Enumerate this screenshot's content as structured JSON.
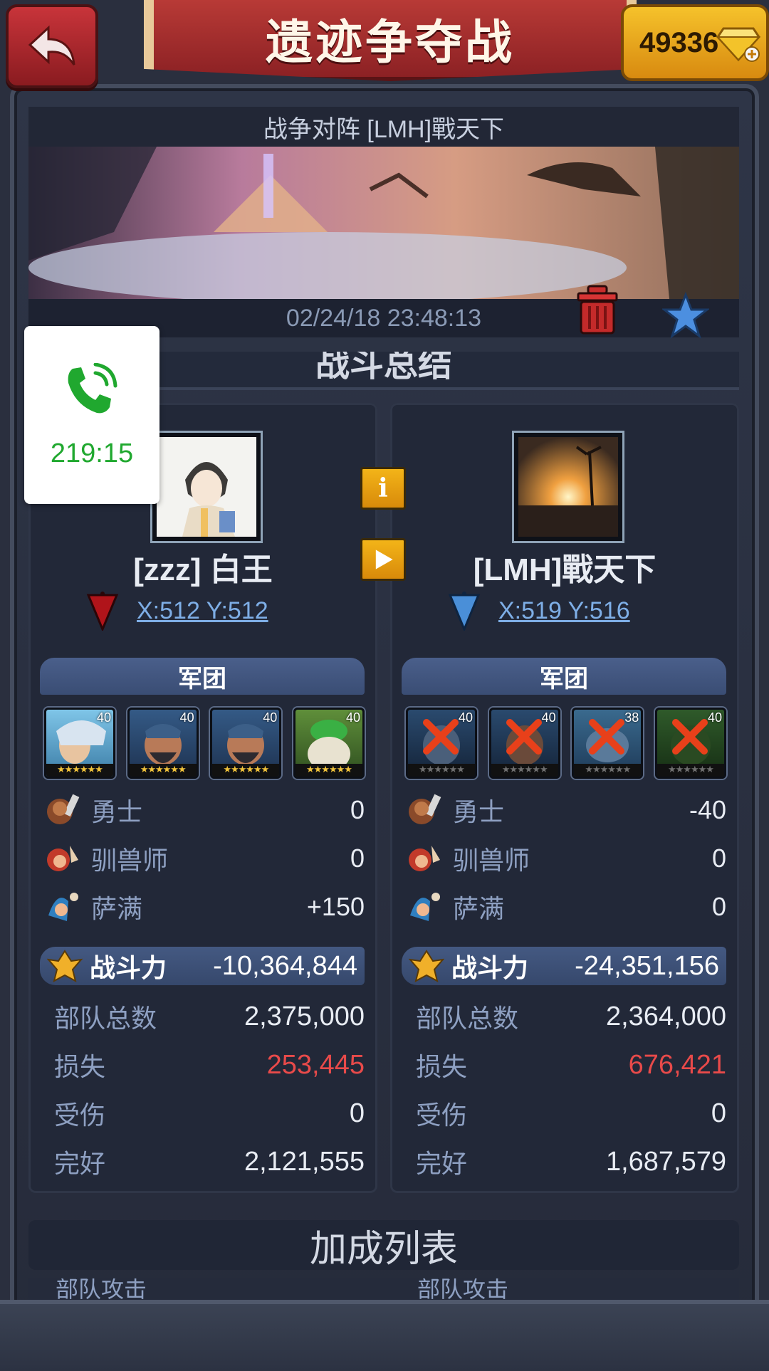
{
  "header": {
    "title": "遗迹争夺战",
    "gems": "49336"
  },
  "battle": {
    "title": "战争对阵 [LMH]戰天下",
    "timestamp": "02/24/18 23:48:13",
    "summary_label": "战斗总结"
  },
  "call_overlay": {
    "timer": "219:15"
  },
  "left": {
    "player_name": "[zzz] 白王",
    "coords": "X:512 Y:512",
    "legion_label": "军团",
    "heroes": [
      {
        "level": "40",
        "dead": false
      },
      {
        "level": "40",
        "dead": false
      },
      {
        "level": "40",
        "dead": false
      },
      {
        "level": "40",
        "dead": false
      }
    ],
    "units": [
      {
        "name": "勇士",
        "value": "0"
      },
      {
        "name": "驯兽师",
        "value": "0"
      },
      {
        "name": "萨满",
        "value": "+150"
      }
    ],
    "power_label": "战斗力",
    "power_value": "-10,364,844",
    "stats": [
      {
        "label": "部队总数",
        "value": "2,375,000",
        "red": false
      },
      {
        "label": "损失",
        "value": "253,445",
        "red": true
      },
      {
        "label": "受伤",
        "value": "0",
        "red": false
      },
      {
        "label": "完好",
        "value": "2,121,555",
        "red": false
      }
    ]
  },
  "right": {
    "player_name": "[LMH]戰天下",
    "coords": "X:519 Y:516",
    "legion_label": "军团",
    "heroes": [
      {
        "level": "40",
        "dead": true
      },
      {
        "level": "40",
        "dead": true
      },
      {
        "level": "38",
        "dead": true
      },
      {
        "level": "40",
        "dead": true
      }
    ],
    "units": [
      {
        "name": "勇士",
        "value": "-40"
      },
      {
        "name": "驯兽师",
        "value": "0"
      },
      {
        "name": "萨满",
        "value": "0"
      }
    ],
    "power_label": "战斗力",
    "power_value": "-24,351,156",
    "stats": [
      {
        "label": "部队总数",
        "value": "2,364,000",
        "red": false
      },
      {
        "label": "损失",
        "value": "676,421",
        "red": true
      },
      {
        "label": "受伤",
        "value": "0",
        "red": false
      },
      {
        "label": "完好",
        "value": "1,687,579",
        "red": false
      }
    ]
  },
  "middle_buttons": {
    "info": "i"
  },
  "bonus": {
    "title": "加成列表",
    "left_sub": "部队攻击",
    "right_sub": "部队攻击"
  },
  "colors": {
    "accent_red": "#e84a4a",
    "link_blue": "#7eaee6",
    "gold": "#f3b418",
    "call_green": "#20a82f"
  }
}
